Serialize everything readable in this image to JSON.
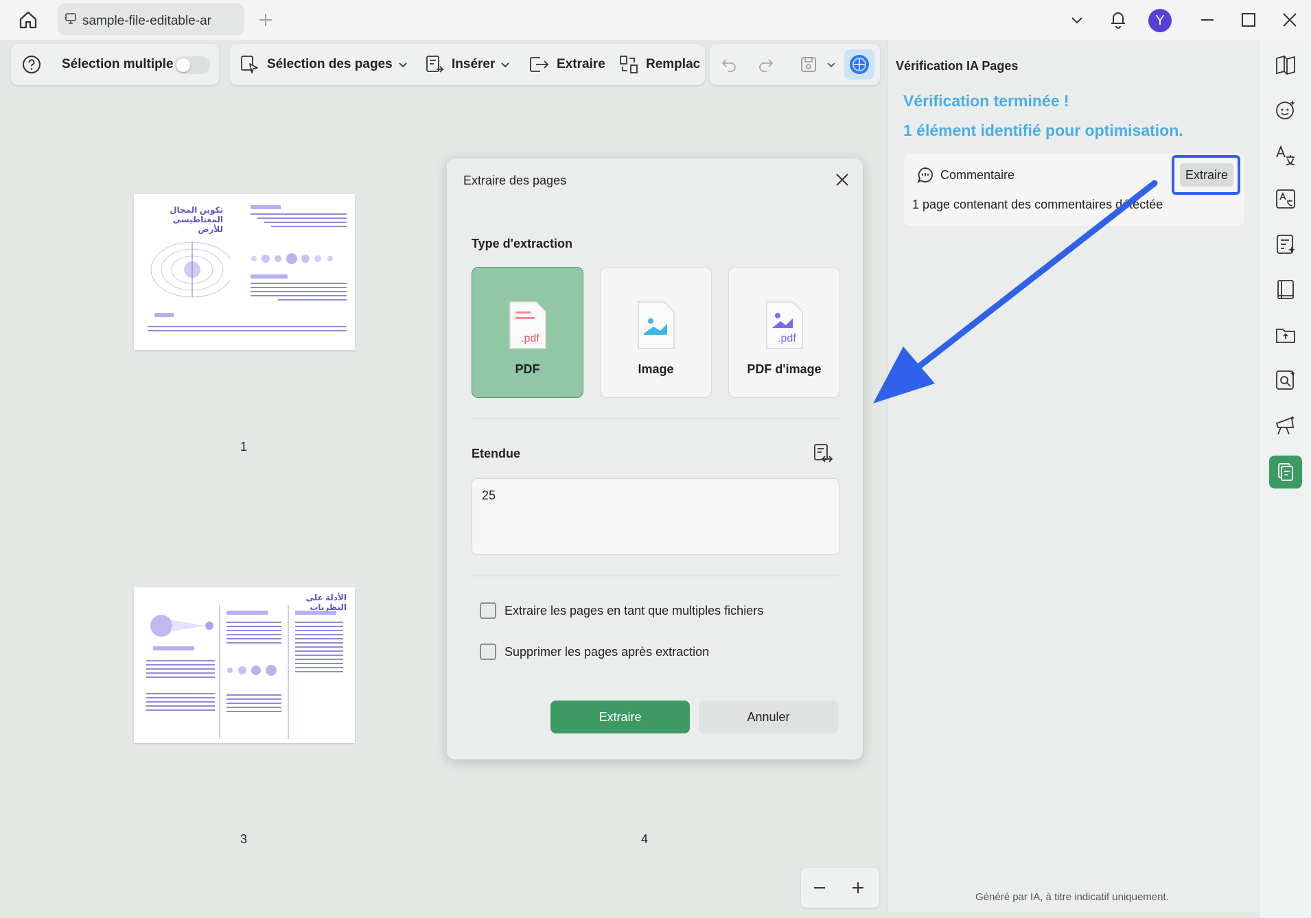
{
  "window": {
    "tab_title": "sample-file-editable-ar",
    "avatar_letter": "Y"
  },
  "toolbar": {
    "multi_select_label": "Sélection multiple",
    "multi_select_on": false,
    "page_selection_label": "Sélection des pages",
    "insert_label": "Insérer",
    "extract_label": "Extraire",
    "replace_label": "Remplac"
  },
  "pages": {
    "numbers": [
      "1",
      "3",
      "4"
    ],
    "thumb1_title_line1": "تكوين المجال",
    "thumb1_title_line2": "المغناطيسي للأرض",
    "thumb3_title": "الأدلة على النظريات"
  },
  "dialog": {
    "title": "Extraire des pages",
    "extraction_type_title": "Type d'extraction",
    "options": [
      {
        "label": "PDF",
        "selected": true
      },
      {
        "label": "Image",
        "selected": false
      },
      {
        "label": "PDF d'image",
        "selected": false
      }
    ],
    "pdf_tag": ".pdf",
    "range_title": "Etendue",
    "range_value": "25",
    "checkbox_multiple_files": "Extraire les pages en tant que multiples fichiers",
    "checkbox_delete_after": "Supprimer les pages après extraction",
    "confirm_label": "Extraire",
    "cancel_label": "Annuler"
  },
  "ai_panel": {
    "title": "Vérification IA Pages",
    "status_line1": "Vérification terminée !",
    "status_line2": "1 élément identifié pour optimisation.",
    "item_title": "Commentaire",
    "item_action": "Extraire",
    "item_description": "1 page contenant des commentaires détectée",
    "footer": "Généré par IA, à titre indicatif uniquement."
  },
  "colors": {
    "accent_green": "#3e9a64",
    "ai_blue": "#4aaeea",
    "highlight_blue": "#2f62e8",
    "avatar": "#5a3fd6"
  }
}
